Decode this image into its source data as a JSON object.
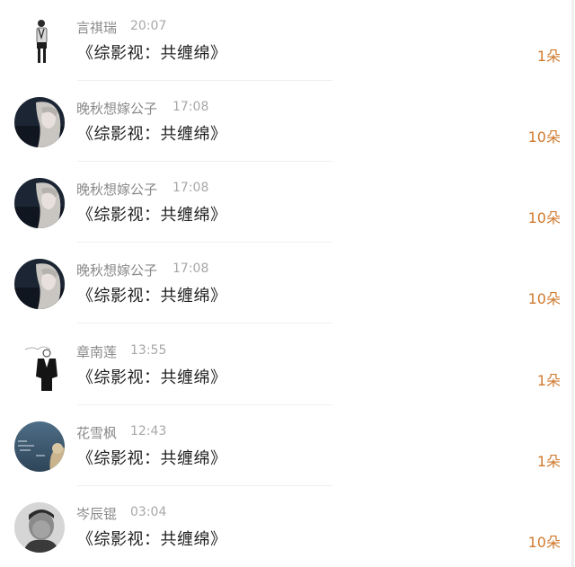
{
  "gift_color": "#d07a2f",
  "items": [
    {
      "name": "言祺瑞",
      "time": "20:07",
      "title": "《综影视：共缠绵》",
      "gift": "1朵",
      "avatar_icon": "bw-figure-avatar-icon"
    },
    {
      "name": "晚秋想嫁公子",
      "time": "17:08",
      "title": "《综影视：共缠绵》",
      "gift": "10朵",
      "avatar_icon": "girl-portrait-avatar-icon"
    },
    {
      "name": "晚秋想嫁公子",
      "time": "17:08",
      "title": "《综影视：共缠绵》",
      "gift": "10朵",
      "avatar_icon": "girl-portrait-avatar-icon"
    },
    {
      "name": "晚秋想嫁公子",
      "time": "17:08",
      "title": "《综影视：共缠绵》",
      "gift": "10朵",
      "avatar_icon": "girl-portrait-avatar-icon"
    },
    {
      "name": "章南莲",
      "time": "13:55",
      "title": "《综影视：共缠绵》",
      "gift": "1朵",
      "avatar_icon": "sketch-figure-avatar-icon"
    },
    {
      "name": "花雪枫",
      "time": "12:43",
      "title": "《综影视：共缠绵》",
      "gift": "1朵",
      "avatar_icon": "night-sky-avatar-icon"
    },
    {
      "name": "岑辰锟",
      "time": "03:04",
      "title": "《综影视：共缠绵》",
      "gift": "10朵",
      "avatar_icon": "man-portrait-avatar-icon"
    }
  ]
}
